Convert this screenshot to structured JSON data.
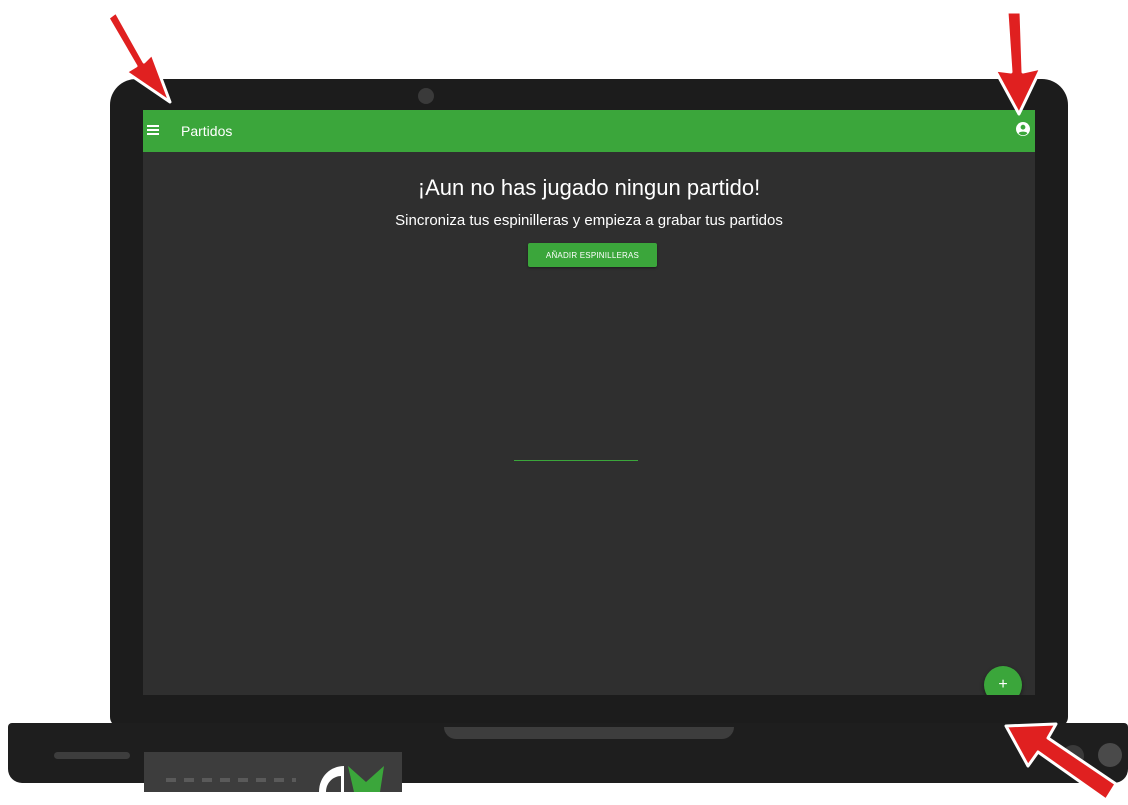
{
  "appbar": {
    "title": "Partidos",
    "menu_icon": "hamburger-menu-icon",
    "profile_icon": "account-circle-icon"
  },
  "empty_state": {
    "title": "¡Aun no has jugado ningun partido!",
    "subtitle": "Sincroniza tus espinilleras y empieza a grabar tus partidos",
    "button_label": "AÑADIR ESPINILLERAS"
  },
  "fab": {
    "label": "+",
    "icon": "add-icon"
  },
  "colors": {
    "accent": "#3ba63b",
    "background": "#2f2f2f",
    "bezel": "#1c1c1c",
    "annotation_arrow": "#e02020"
  }
}
